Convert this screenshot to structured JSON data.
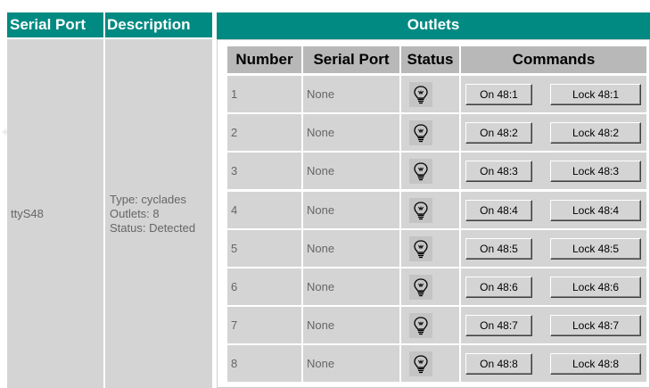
{
  "headers": {
    "serial_port": "Serial Port",
    "description": "Description",
    "outlets": "Outlets"
  },
  "port": {
    "name": "ttyS48",
    "description_lines": [
      "Type: cyclades",
      "Outlets: 8",
      "Status: Detected"
    ]
  },
  "outlet_table": {
    "columns": [
      "Number",
      "Serial Port",
      "Status",
      "Commands"
    ],
    "rows": [
      {
        "number": "1",
        "serial_port": "None",
        "status_icon": "lightbulb-icon",
        "on_label": "On 48:1",
        "lock_label": "Lock 48:1"
      },
      {
        "number": "2",
        "serial_port": "None",
        "status_icon": "lightbulb-icon",
        "on_label": "On 48:2",
        "lock_label": "Lock 48:2"
      },
      {
        "number": "3",
        "serial_port": "None",
        "status_icon": "lightbulb-icon",
        "on_label": "On 48:3",
        "lock_label": "Lock 48:3"
      },
      {
        "number": "4",
        "serial_port": "None",
        "status_icon": "lightbulb-icon",
        "on_label": "On 48:4",
        "lock_label": "Lock 48:4"
      },
      {
        "number": "5",
        "serial_port": "None",
        "status_icon": "lightbulb-icon",
        "on_label": "On 48:5",
        "lock_label": "Lock 48:5"
      },
      {
        "number": "6",
        "serial_port": "None",
        "status_icon": "lightbulb-icon",
        "on_label": "On 48:6",
        "lock_label": "Lock 48:6"
      },
      {
        "number": "7",
        "serial_port": "None",
        "status_icon": "lightbulb-icon",
        "on_label": "On 48:7",
        "lock_label": "Lock 48:7"
      },
      {
        "number": "8",
        "serial_port": "None",
        "status_icon": "lightbulb-icon",
        "on_label": "On 48:8",
        "lock_label": "Lock 48:8"
      }
    ]
  },
  "colors": {
    "header_teal": "#008a82",
    "cell_gray": "#d4d4d4",
    "header_gray": "#b8b8b8"
  }
}
